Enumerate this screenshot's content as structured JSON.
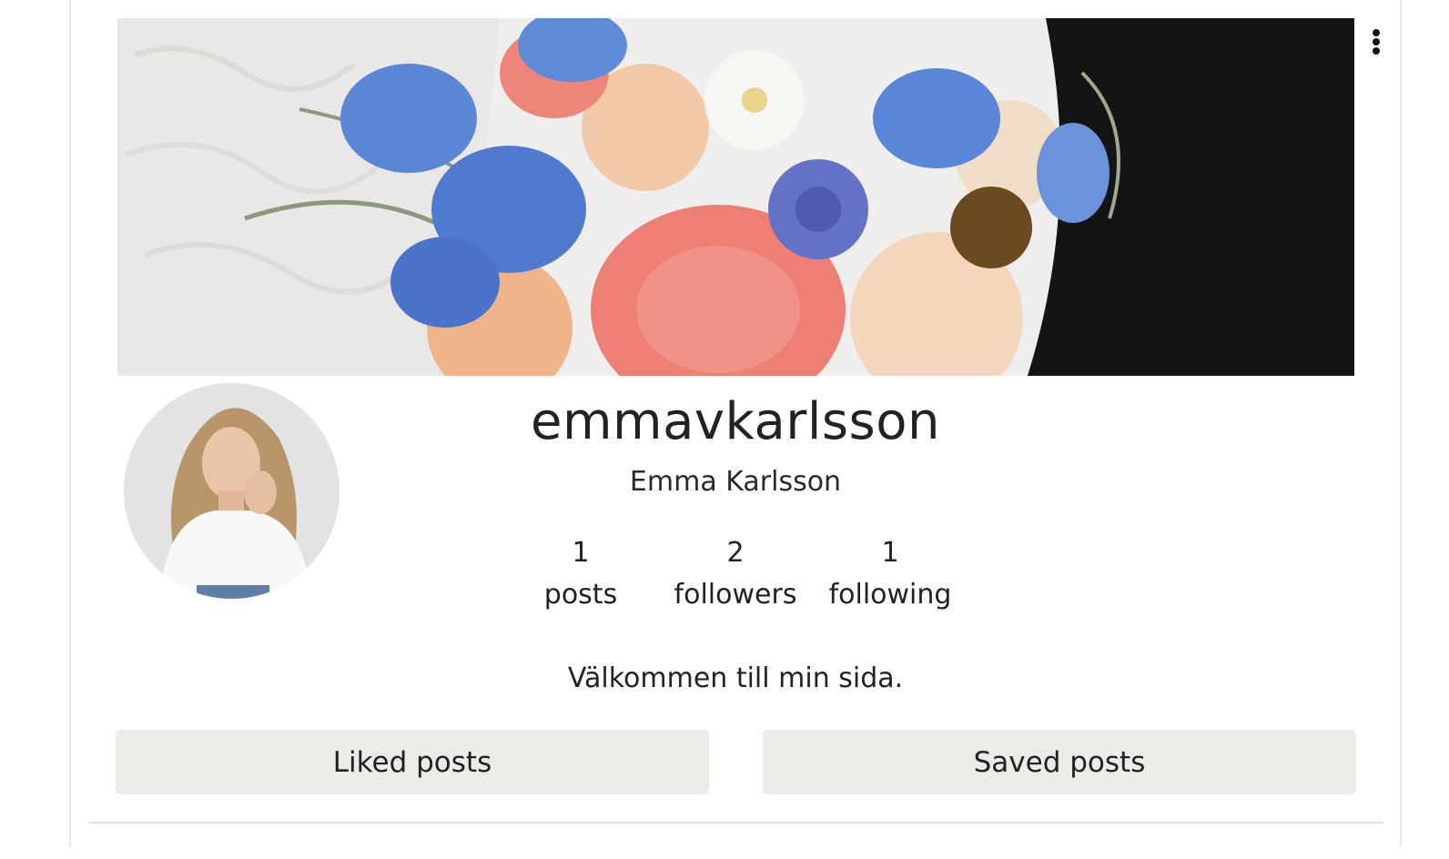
{
  "profile": {
    "username": "emmavkarlsson",
    "full_name": "Emma Karlsson",
    "bio": "Välkommen till min sida.",
    "stats": [
      {
        "value": "1",
        "label": "posts"
      },
      {
        "value": "2",
        "label": "followers"
      },
      {
        "value": "1",
        "label": "following"
      }
    ]
  },
  "tabs": {
    "liked": "Liked posts",
    "saved": "Saved posts"
  },
  "icons": {
    "menu": "more-vertical-icon"
  },
  "colors": {
    "tab_background": "#edebe8",
    "text": "#222222",
    "divider": "#e6e6e6"
  }
}
